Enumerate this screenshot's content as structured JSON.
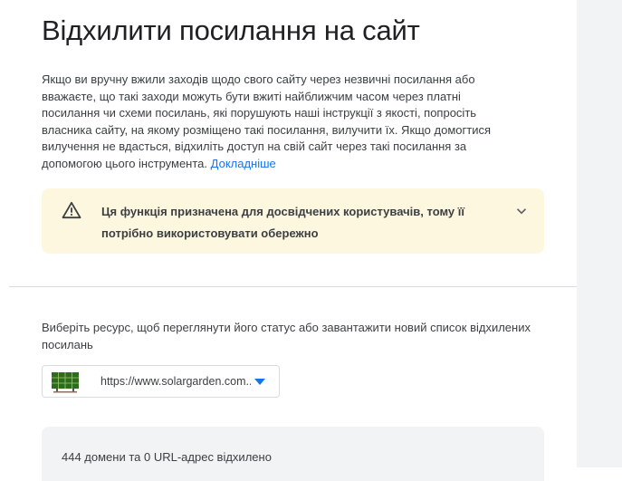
{
  "page": {
    "title": "Відхилити посилання на сайт",
    "description": "Якщо ви вручну вжили заходів щодо свого сайту через незвичні посилання або вважаєте, що такі заходи можуть бути вжиті найближчим часом через платні посилання чи схеми посилань, які порушують наші інструкції з якості, попросіть власника сайту, на якому розміщено такі посилання, вилучити їх. Якщо домогтися вилучення не вдасться, відхиліть доступ на свій сайт через такі посилання за допомогою цього інструмента.",
    "learn_more_label": "Докладніше"
  },
  "warning": {
    "icon": "warning-icon",
    "text": "Ця функція призначена для досвідчених користувачів, тому її потрібно використовувати обережно",
    "expand_icon": "chevron-down-icon",
    "background": "#fef7e0"
  },
  "resource": {
    "prompt": "Виберіть ресурс, щоб переглянути його статус або завантажити новий список відхилених посилань",
    "selected_url": "https://www.solargarden.com...",
    "favicon": "solar-panel-icon",
    "dropdown_icon": "dropdown-arrow-icon",
    "accent": "#1a73e8"
  },
  "status": {
    "text": "444 домени та 0 URL-адрес відхилено"
  }
}
